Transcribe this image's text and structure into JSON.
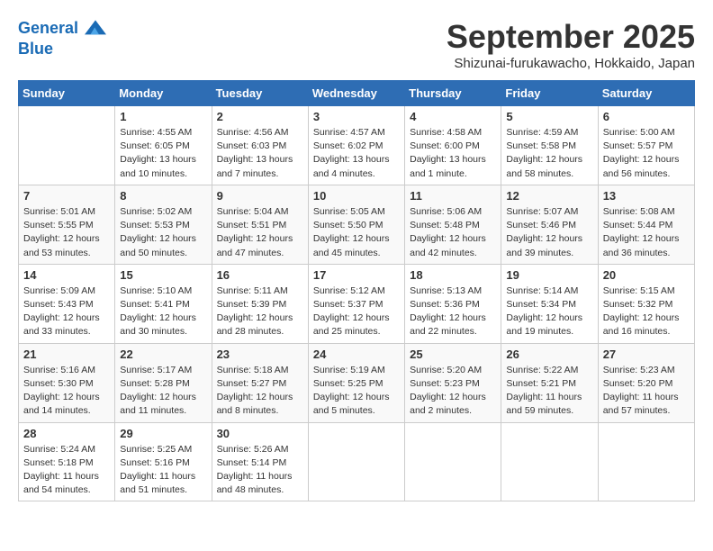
{
  "header": {
    "logo_line1": "General",
    "logo_line2": "Blue",
    "month": "September 2025",
    "location": "Shizunai-furukawacho, Hokkaido, Japan"
  },
  "days_of_week": [
    "Sunday",
    "Monday",
    "Tuesday",
    "Wednesday",
    "Thursday",
    "Friday",
    "Saturday"
  ],
  "weeks": [
    [
      {
        "day": "",
        "text": ""
      },
      {
        "day": "1",
        "text": "Sunrise: 4:55 AM\nSunset: 6:05 PM\nDaylight: 13 hours\nand 10 minutes."
      },
      {
        "day": "2",
        "text": "Sunrise: 4:56 AM\nSunset: 6:03 PM\nDaylight: 13 hours\nand 7 minutes."
      },
      {
        "day": "3",
        "text": "Sunrise: 4:57 AM\nSunset: 6:02 PM\nDaylight: 13 hours\nand 4 minutes."
      },
      {
        "day": "4",
        "text": "Sunrise: 4:58 AM\nSunset: 6:00 PM\nDaylight: 13 hours\nand 1 minute."
      },
      {
        "day": "5",
        "text": "Sunrise: 4:59 AM\nSunset: 5:58 PM\nDaylight: 12 hours\nand 58 minutes."
      },
      {
        "day": "6",
        "text": "Sunrise: 5:00 AM\nSunset: 5:57 PM\nDaylight: 12 hours\nand 56 minutes."
      }
    ],
    [
      {
        "day": "7",
        "text": "Sunrise: 5:01 AM\nSunset: 5:55 PM\nDaylight: 12 hours\nand 53 minutes."
      },
      {
        "day": "8",
        "text": "Sunrise: 5:02 AM\nSunset: 5:53 PM\nDaylight: 12 hours\nand 50 minutes."
      },
      {
        "day": "9",
        "text": "Sunrise: 5:04 AM\nSunset: 5:51 PM\nDaylight: 12 hours\nand 47 minutes."
      },
      {
        "day": "10",
        "text": "Sunrise: 5:05 AM\nSunset: 5:50 PM\nDaylight: 12 hours\nand 45 minutes."
      },
      {
        "day": "11",
        "text": "Sunrise: 5:06 AM\nSunset: 5:48 PM\nDaylight: 12 hours\nand 42 minutes."
      },
      {
        "day": "12",
        "text": "Sunrise: 5:07 AM\nSunset: 5:46 PM\nDaylight: 12 hours\nand 39 minutes."
      },
      {
        "day": "13",
        "text": "Sunrise: 5:08 AM\nSunset: 5:44 PM\nDaylight: 12 hours\nand 36 minutes."
      }
    ],
    [
      {
        "day": "14",
        "text": "Sunrise: 5:09 AM\nSunset: 5:43 PM\nDaylight: 12 hours\nand 33 minutes."
      },
      {
        "day": "15",
        "text": "Sunrise: 5:10 AM\nSunset: 5:41 PM\nDaylight: 12 hours\nand 30 minutes."
      },
      {
        "day": "16",
        "text": "Sunrise: 5:11 AM\nSunset: 5:39 PM\nDaylight: 12 hours\nand 28 minutes."
      },
      {
        "day": "17",
        "text": "Sunrise: 5:12 AM\nSunset: 5:37 PM\nDaylight: 12 hours\nand 25 minutes."
      },
      {
        "day": "18",
        "text": "Sunrise: 5:13 AM\nSunset: 5:36 PM\nDaylight: 12 hours\nand 22 minutes."
      },
      {
        "day": "19",
        "text": "Sunrise: 5:14 AM\nSunset: 5:34 PM\nDaylight: 12 hours\nand 19 minutes."
      },
      {
        "day": "20",
        "text": "Sunrise: 5:15 AM\nSunset: 5:32 PM\nDaylight: 12 hours\nand 16 minutes."
      }
    ],
    [
      {
        "day": "21",
        "text": "Sunrise: 5:16 AM\nSunset: 5:30 PM\nDaylight: 12 hours\nand 14 minutes."
      },
      {
        "day": "22",
        "text": "Sunrise: 5:17 AM\nSunset: 5:28 PM\nDaylight: 12 hours\nand 11 minutes."
      },
      {
        "day": "23",
        "text": "Sunrise: 5:18 AM\nSunset: 5:27 PM\nDaylight: 12 hours\nand 8 minutes."
      },
      {
        "day": "24",
        "text": "Sunrise: 5:19 AM\nSunset: 5:25 PM\nDaylight: 12 hours\nand 5 minutes."
      },
      {
        "day": "25",
        "text": "Sunrise: 5:20 AM\nSunset: 5:23 PM\nDaylight: 12 hours\nand 2 minutes."
      },
      {
        "day": "26",
        "text": "Sunrise: 5:22 AM\nSunset: 5:21 PM\nDaylight: 11 hours\nand 59 minutes."
      },
      {
        "day": "27",
        "text": "Sunrise: 5:23 AM\nSunset: 5:20 PM\nDaylight: 11 hours\nand 57 minutes."
      }
    ],
    [
      {
        "day": "28",
        "text": "Sunrise: 5:24 AM\nSunset: 5:18 PM\nDaylight: 11 hours\nand 54 minutes."
      },
      {
        "day": "29",
        "text": "Sunrise: 5:25 AM\nSunset: 5:16 PM\nDaylight: 11 hours\nand 51 minutes."
      },
      {
        "day": "30",
        "text": "Sunrise: 5:26 AM\nSunset: 5:14 PM\nDaylight: 11 hours\nand 48 minutes."
      },
      {
        "day": "",
        "text": ""
      },
      {
        "day": "",
        "text": ""
      },
      {
        "day": "",
        "text": ""
      },
      {
        "day": "",
        "text": ""
      }
    ]
  ]
}
